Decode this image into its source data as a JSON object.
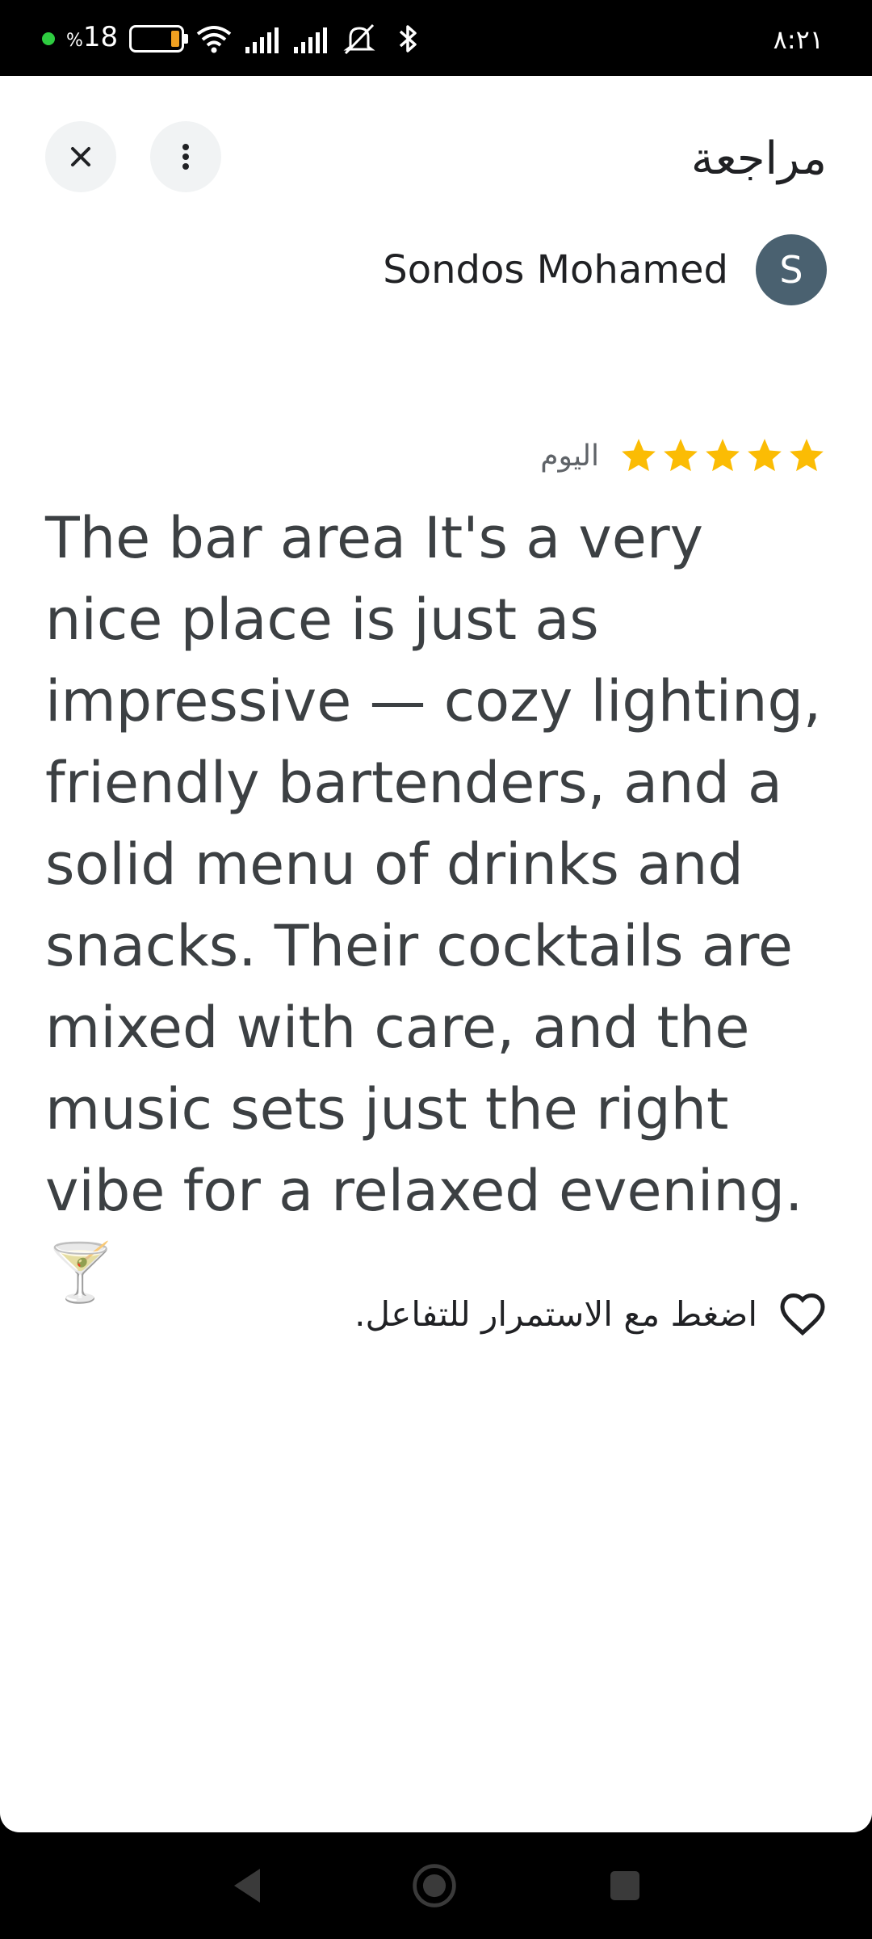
{
  "status_bar": {
    "battery_percent_symbol": "%",
    "battery_level": "18",
    "time": "٨:٢١",
    "icons": [
      "battery-icon",
      "wifi-icon",
      "signal-icon",
      "signal-icon",
      "bell-off-icon",
      "bluetooth-icon"
    ],
    "colors": {
      "dot": "#2ecc40",
      "battery_fill": "#f0a020"
    }
  },
  "sheet": {
    "title": "مراجعة",
    "close_icon": "close-icon",
    "more_icon": "more-vertical-icon"
  },
  "review": {
    "reviewer_name": "Sondos Mohamed",
    "avatar_initial": "S",
    "avatar_color": "#4a6170",
    "rating": 5,
    "rating_max": 5,
    "star_color": "#fbbc04",
    "date": "اليوم",
    "text": "The bar area It's a very nice place  is just as impressive — cozy lighting, friendly bartenders, and a solid menu of drinks and snacks. Their cocktails are mixed with care, and the music sets just the right vibe for a relaxed evening. 🍸",
    "react_label": "اضغط مع الاستمرار للتفاعل.",
    "react_icon": "heart-outline-icon"
  },
  "nav_bar": {
    "icons": [
      "back-icon",
      "home-icon",
      "recents-icon"
    ]
  }
}
